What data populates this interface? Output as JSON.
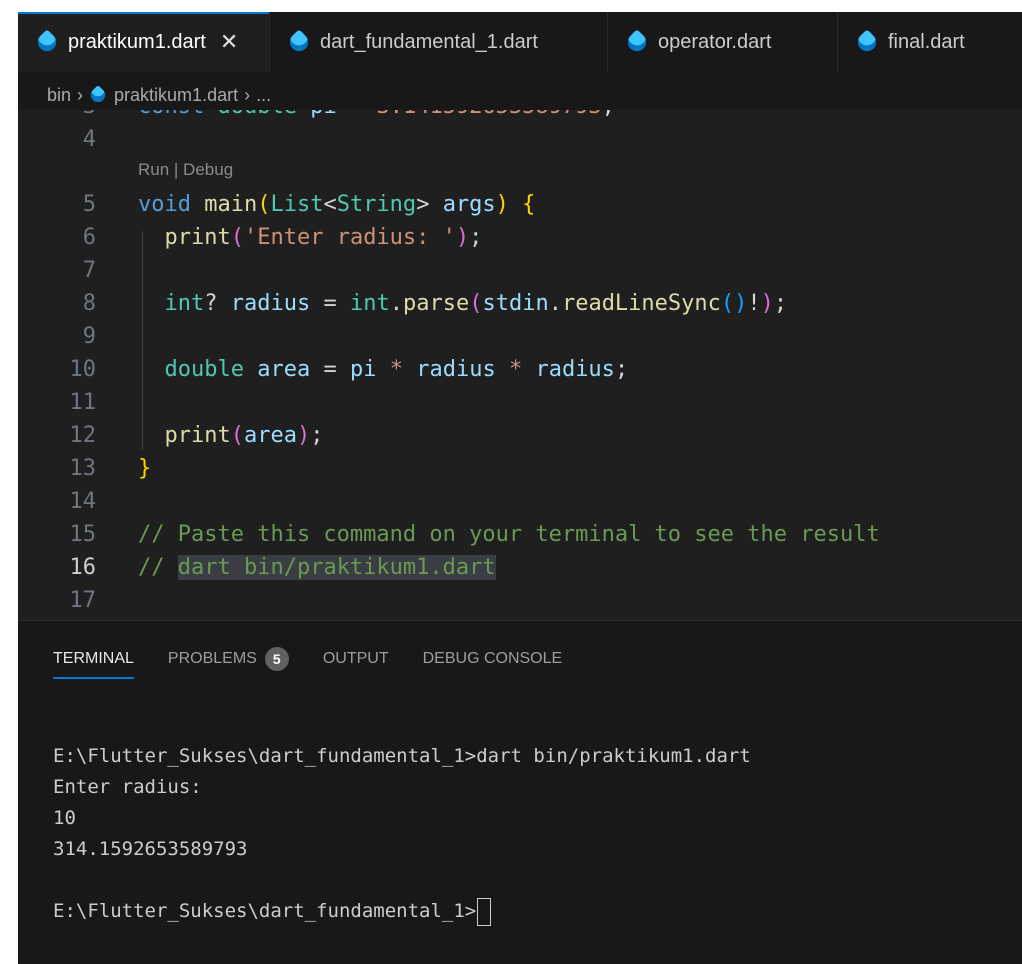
{
  "tabs": [
    {
      "label": "praktikum1.dart",
      "active": true,
      "close": "✕"
    },
    {
      "label": "dart_fundamental_1.dart",
      "active": false
    },
    {
      "label": "operator.dart",
      "active": false
    },
    {
      "label": "final.dart",
      "active": false
    }
  ],
  "breadcrumb": {
    "folder": "bin",
    "file": "praktikum1.dart",
    "more": "..."
  },
  "editor": {
    "codelens": "Run | Debug",
    "current_line": 16
  },
  "panel": {
    "tabs": [
      "TERMINAL",
      "PROBLEMS",
      "OUTPUT",
      "DEBUG CONSOLE"
    ],
    "problems_count": "5",
    "terminal_lines": [
      "E:\\Flutter_Sukses\\dart_fundamental_1>dart bin/praktikum1.dart",
      "Enter radius:",
      "10",
      "314.1592653589793",
      "",
      "E:\\Flutter_Sukses\\dart_fundamental_1>"
    ]
  },
  "colors": {
    "accent": "#0078d4",
    "editor_bg": "#1f1f1f",
    "panel_bg": "#181818"
  }
}
